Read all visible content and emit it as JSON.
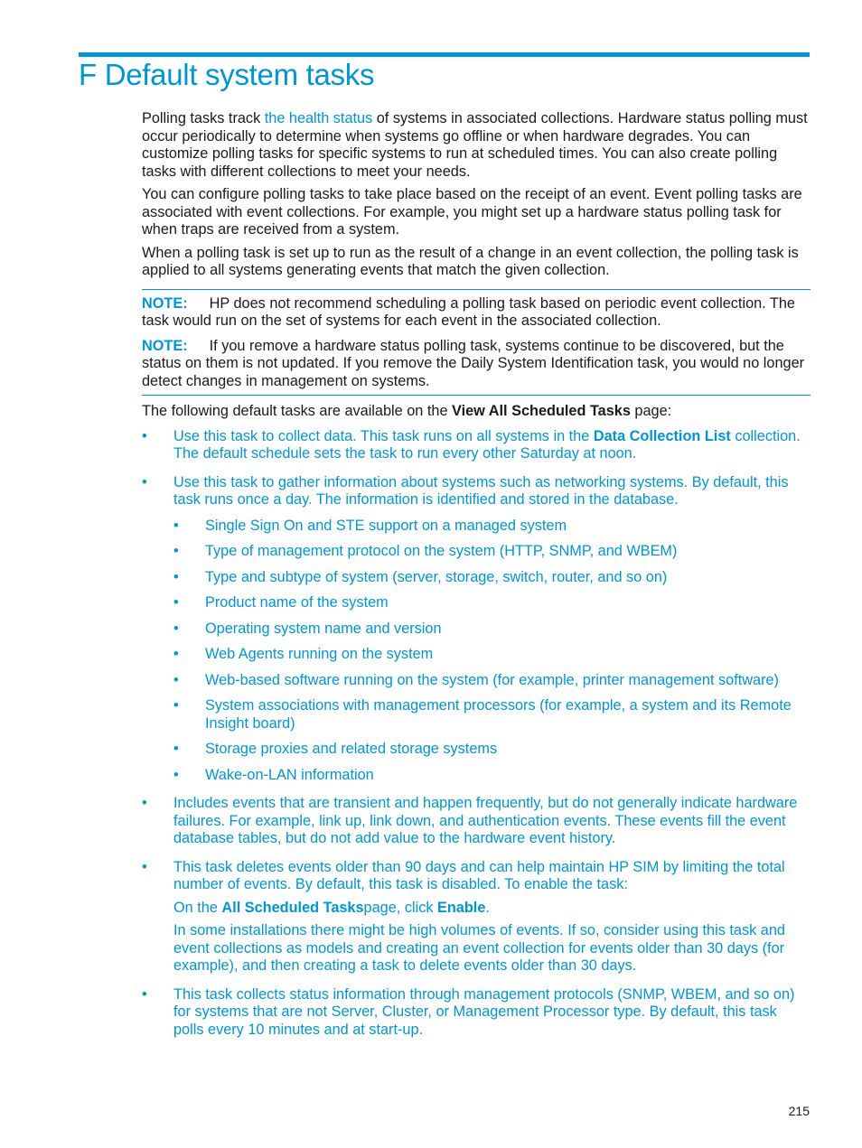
{
  "header": {
    "title": "F Default system tasks"
  },
  "intro": {
    "p1_pre": "Polling tasks track ",
    "p1_link": "the health status",
    "p1_post": " of systems in associated collections. Hardware status polling must occur periodically to determine when systems go offline or when hardware degrades. You can customize polling tasks for specific systems to run at scheduled times. You can also create polling tasks with different collections to meet your needs.",
    "p2": "You can configure polling tasks to take place based on the receipt of an event. Event polling tasks are associated with event collections. For example, you might set up a hardware status polling task for when traps are received from a system.",
    "p3": "When a polling task is set up to run as the result of a change in an event collection, the polling task is applied to all systems generating events that match the given collection."
  },
  "notes": [
    {
      "label": "NOTE:",
      "text": "HP does not recommend scheduling a polling task based on periodic event collection. The task would run on the set of systems for each event in the associated collection."
    },
    {
      "label": "NOTE:",
      "text": "If you remove a hardware status polling task, systems continue to be discovered, but the status on them is not updated. If you remove the Daily System Identification task, you would no longer detect changes in management on systems."
    }
  ],
  "tasks_intro": {
    "pre": "The following default tasks are available on the ",
    "bold": "View All Scheduled Tasks",
    "post": " page:"
  },
  "tasks": [
    {
      "pre": "Use this task to collect data. This task runs on all systems in the ",
      "bold": "Data Collection List",
      "post": " collection. The default schedule sets the task to run every other Saturday at noon."
    },
    {
      "text": "Use this task to gather information about systems such as networking systems. By default, this task runs once a day. The information is identified and stored in the database.",
      "subitems": [
        "Single Sign On and STE support on a managed system",
        "Type of management protocol on the system (HTTP, SNMP, and WBEM)",
        "Type and subtype of system (server, storage, switch, router, and so on)",
        "Product name of the system",
        "Operating system name and version",
        "Web Agents running on the system",
        "Web-based software running on the system (for example, printer management software)",
        "System associations with management processors (for example, a system and its Remote Insight board)",
        "Storage proxies and related storage systems",
        "Wake-on-LAN information"
      ]
    },
    {
      "text": "Includes events that are transient and happen frequently, but do not generally indicate hardware failures. For example, link up, link down, and authentication events. These events fill the event database tables, but do not add value to the hardware event history."
    },
    {
      "text": "This task deletes events older than 90 days and can help maintain HP SIM by limiting the total number of events. By default, this task is disabled. To enable the task:",
      "step_pre": "On the ",
      "step_bold1": "All Scheduled Tasks",
      "step_mid": "page, click ",
      "step_bold2": "Enable",
      "step_post": ".",
      "extra": "In some installations there might be high volumes of events. If so, consider using this task and event collections as models and creating an event collection for events older than 30 days (for example), and then creating a task to delete events older than 30 days."
    },
    {
      "text": "This task collects status information through management protocols (SNMP, WBEM, and so on) for systems that are not Server, Cluster, or Management Processor type. By default, this task polls every 10 minutes and at start-up."
    }
  ],
  "footer": {
    "page_number": "215"
  },
  "colors": {
    "accent": "#0096d6",
    "text": "#1a1a1a"
  }
}
